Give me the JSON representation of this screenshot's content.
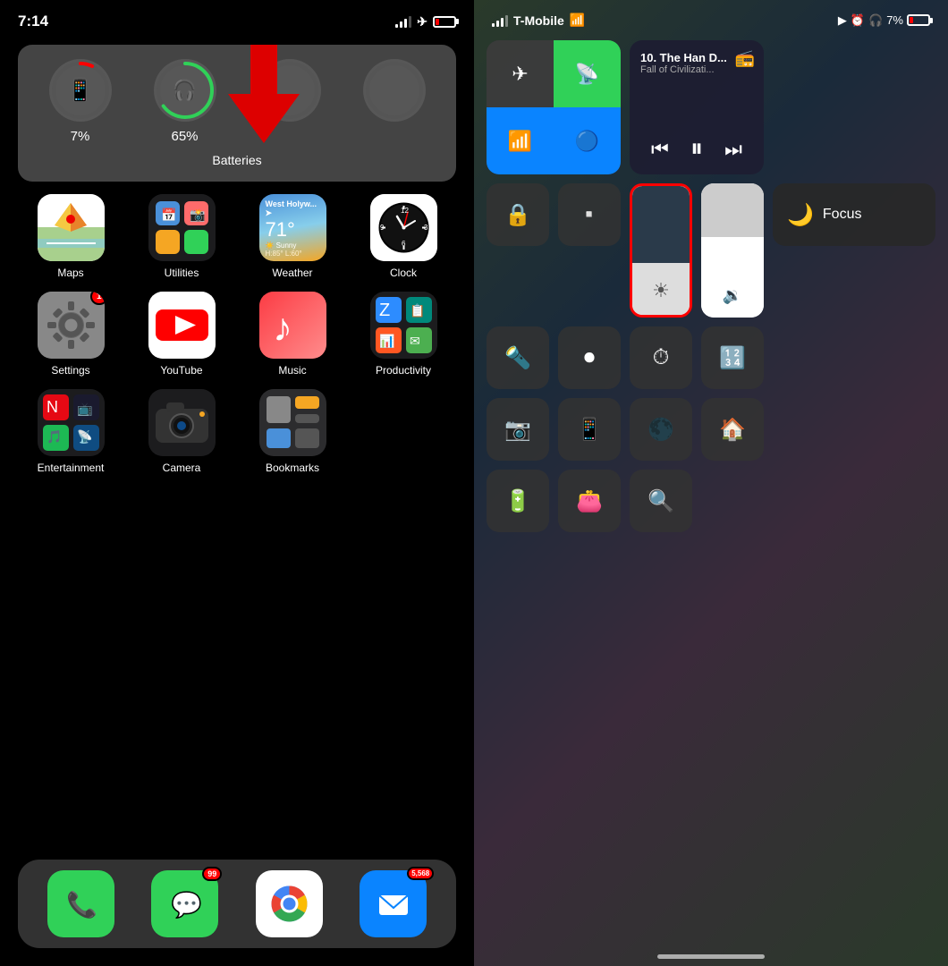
{
  "left": {
    "statusBar": {
      "time": "7:14",
      "locationIcon": "▶",
      "battery": "7%"
    },
    "batteriesWidget": {
      "title": "Batteries",
      "items": [
        {
          "icon": "📱",
          "percent": "7%",
          "color": "#f00",
          "ring": 7
        },
        {
          "icon": "🎧",
          "percent": "65%",
          "color": "#30d158",
          "ring": 65
        },
        {
          "icon": "",
          "percent": "",
          "color": "transparent",
          "ring": 0
        },
        {
          "icon": "",
          "percent": "",
          "color": "transparent",
          "ring": 0
        }
      ]
    },
    "apps": [
      {
        "name": "Maps",
        "type": "maps"
      },
      {
        "name": "Utilities",
        "type": "utilities"
      },
      {
        "name": "Weather",
        "type": "weather"
      },
      {
        "name": "Clock",
        "type": "clock"
      },
      {
        "name": "Settings",
        "type": "settings",
        "badge": "1"
      },
      {
        "name": "YouTube",
        "type": "youtube"
      },
      {
        "name": "Music",
        "type": "music"
      },
      {
        "name": "Productivity",
        "type": "productivity"
      },
      {
        "name": "Entertainment",
        "type": "entertainment"
      },
      {
        "name": "Camera",
        "type": "camera"
      },
      {
        "name": "Bookmarks",
        "type": "bookmarks"
      }
    ],
    "dock": [
      {
        "name": "Phone",
        "type": "phone"
      },
      {
        "name": "Messages",
        "type": "messages",
        "badge": "99"
      },
      {
        "name": "Chrome",
        "type": "chrome"
      },
      {
        "name": "Mail",
        "type": "mail",
        "badge": "5,568"
      }
    ]
  },
  "right": {
    "statusBar": {
      "carrier": "T-Mobile",
      "wifi": true,
      "location": true,
      "alarm": true,
      "headphones": true,
      "battery": "7%"
    },
    "media": {
      "title": "10. The Han D...",
      "subtitle": "Fall of Civilizati...",
      "icon": "podcast"
    },
    "focus": {
      "label": "Focus"
    },
    "controls": {
      "airplaneMode": false,
      "hotspot": true,
      "wifi": true,
      "bluetooth": true,
      "brightness": 35,
      "volume": 55,
      "flashlight": true,
      "screenRecord": true,
      "timer": true,
      "calculator": true,
      "camera": true,
      "remote": true,
      "darkMode": true,
      "homeKit": true,
      "battery": true,
      "wallet": true,
      "magnifier": true
    }
  }
}
